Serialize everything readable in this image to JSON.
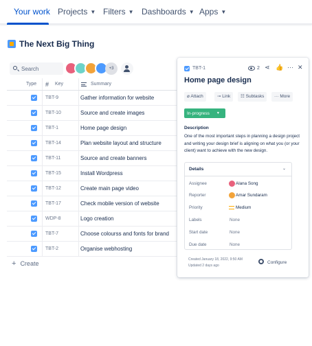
{
  "nav": {
    "items": [
      {
        "label": "Your work",
        "dropdown": false
      },
      {
        "label": "Projects",
        "dropdown": true
      },
      {
        "label": "Filters",
        "dropdown": true
      },
      {
        "label": "Dashboards",
        "dropdown": true
      },
      {
        "label": "Apps",
        "dropdown": true
      }
    ],
    "active_index": 0
  },
  "project": {
    "title": "The Next Big Thing",
    "icon": "project-icon"
  },
  "toolbar": {
    "search_placeholder": "Search",
    "avatar_overflow": "+3",
    "avatar_colors": [
      "#e8617c",
      "#6dd3c9",
      "#f2a33a",
      "#4c9aff"
    ]
  },
  "table": {
    "headers": {
      "type": "Type",
      "key": "Key",
      "summary": "Summary"
    },
    "rows": [
      {
        "key": "TBT-9",
        "summary": "Gather information for website"
      },
      {
        "key": "TBT-10",
        "summary": "Source and create images"
      },
      {
        "key": "TBT-1",
        "summary": "Home page design"
      },
      {
        "key": "TBT-14",
        "summary": "Plan website layout and structure"
      },
      {
        "key": "TBT-11",
        "summary": "Source and create banners"
      },
      {
        "key": "TBT-15",
        "summary": "Install Wordpress"
      },
      {
        "key": "TBT-12",
        "summary": "Create main page video"
      },
      {
        "key": "TBT-17",
        "summary": "Check mobile version of website"
      },
      {
        "key": "WDP-8",
        "summary": "Logo creation"
      },
      {
        "key": "TBT-7",
        "summary": "Choose colourss and fonts for brand"
      },
      {
        "key": "TBT-2",
        "summary": "Organise webhosting"
      }
    ],
    "create_label": "Create"
  },
  "detail": {
    "key": "TBT-1",
    "watch_count": "2",
    "title": "Home page design",
    "actions": {
      "attach": "Attach",
      "link": "Link",
      "subtasks": "Subtasks",
      "more": "More"
    },
    "status": "In-progress",
    "status_color": "#36b37e",
    "description_label": "Description",
    "description": "One of the most important steps in planning a design project and writing your design brief is aligning on what you (or your client) want to achieve with the new design.",
    "details": {
      "heading": "Details",
      "fields": {
        "assignee": {
          "label": "Assignee",
          "value": "Alana Song"
        },
        "reporter": {
          "label": "Reporter",
          "value": "Amar Sundaram"
        },
        "priority": {
          "label": "Priority",
          "value": "Medium"
        },
        "labels": {
          "label": "Labels",
          "value": "None"
        },
        "start_date": {
          "label": "Start date",
          "value": "None"
        },
        "due_date": {
          "label": "Due date",
          "value": "None"
        }
      }
    },
    "created": "Created January 18, 2022, 9:50 AM",
    "updated": "Updated 2 days ago",
    "configure_label": "Configure"
  }
}
